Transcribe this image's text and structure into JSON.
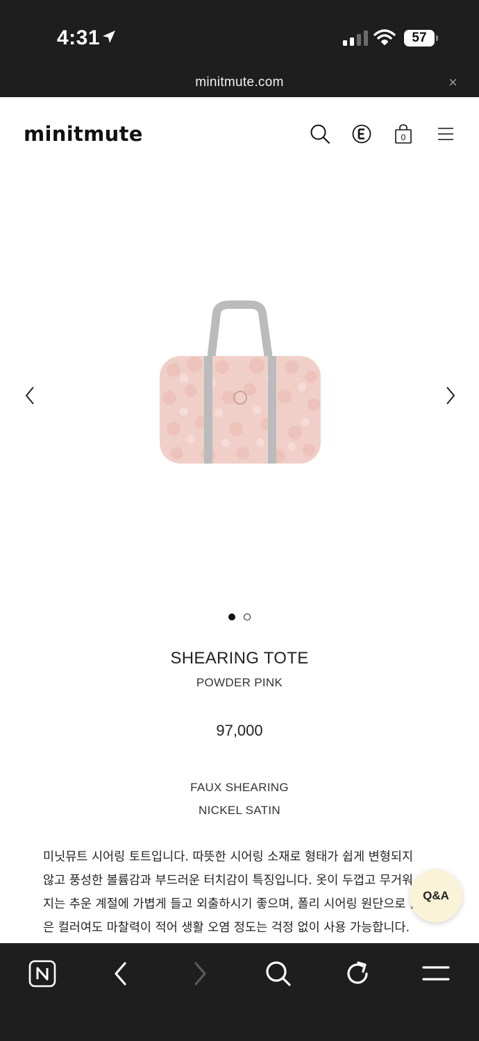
{
  "status_bar": {
    "time": "4:31",
    "battery": "57",
    "icons": [
      "location-arrow-icon",
      "cellular-signal-icon",
      "wifi-icon",
      "battery-icon"
    ]
  },
  "browser": {
    "url": "minitmute.com",
    "close_symbol": "×"
  },
  "header": {
    "logo": "minitmute",
    "icons": [
      "search-icon",
      "e-coin-icon",
      "shopping-bag-icon",
      "menu-icon"
    ],
    "cart_count": "0"
  },
  "gallery": {
    "total_slides": 2,
    "active_slide": 1
  },
  "product": {
    "name": "SHEARING TOTE",
    "color": "POWDER PINK",
    "price": "97,000",
    "materials": [
      "FAUX SHEARING",
      "NICKEL SATIN"
    ],
    "description_lines": [
      "미닛뮤트 시어링 토트입니다. 따뜻한 시어링 소재로 형태가 쉽게 변형되지",
      "않고 풍성한 볼륨감과 부드러운 터치감이 특징입니다. 옷이 두껍고 무거워",
      "지는 추운 계절에 가볍게 들고 외출하시기 좋으며, 폴리 시어링 원단으로 밝",
      "은 컬러여도 마찰력이 적어 생활 오염 정도는 걱정 없이 사용 가능합니다."
    ]
  },
  "qa_button": {
    "label": "Q&A"
  },
  "toolbar": {
    "icons": [
      "naver-home-icon",
      "back-arrow-icon",
      "forward-arrow-icon",
      "search-icon",
      "refresh-icon",
      "menu-icon"
    ]
  },
  "colors": {
    "chrome_bg": "#1e1e1e",
    "page_bg": "#ffffff",
    "bag_pink": "#f1cfc9",
    "strap_gray": "#b9bcbb",
    "qa_bg": "#fbf3d8"
  }
}
